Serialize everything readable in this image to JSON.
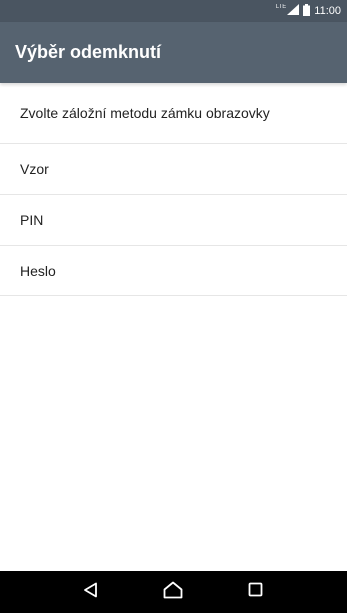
{
  "status_bar": {
    "network": "LTE",
    "time": "11:00",
    "icons": [
      "signal-icon",
      "battery-icon"
    ]
  },
  "app_bar": {
    "title": "Výběr odemknutí"
  },
  "main": {
    "prompt": "Zvolte záložní metodu zámku obrazovky",
    "options": [
      {
        "label": "Vzor"
      },
      {
        "label": "PIN"
      },
      {
        "label": "Heslo"
      }
    ]
  },
  "nav_bar": {
    "buttons": [
      "back-icon",
      "home-icon",
      "recents-icon"
    ]
  },
  "colors": {
    "status_bar": "#4a5561",
    "app_bar": "#566370",
    "nav_bar": "#000000"
  }
}
